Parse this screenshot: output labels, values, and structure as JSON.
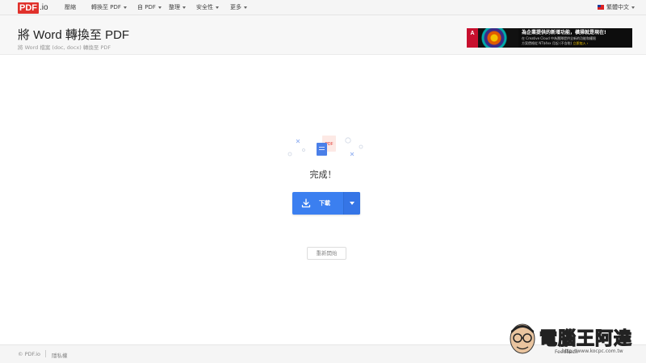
{
  "nav": {
    "logo_pdf": "PDF",
    "logo_io": ".io",
    "items": [
      {
        "label": "壓縮",
        "dropdown": false
      },
      {
        "label": "轉換至 PDF",
        "dropdown": true
      },
      {
        "label": "自 PDF",
        "dropdown": true
      },
      {
        "label": "整理",
        "dropdown": true
      },
      {
        "label": "安全性",
        "dropdown": true
      },
      {
        "label": "更多",
        "dropdown": true
      }
    ],
    "language": "繁體中文"
  },
  "header": {
    "title": "將 Word 轉換至 PDF",
    "subtitle": "將 Word 檔案 (doc, docx) 轉換至 PDF"
  },
  "ad": {
    "logo": "A",
    "line1": "為企業提供的新增功能，橫掃就是現在!",
    "line2": "在 Creative Cloud 中為團隊提供全新的功能和權限",
    "line3": "方案價格從 NT$4xx 月起 (不含稅)",
    "cta": "立即加入 ›"
  },
  "main": {
    "file_badge": "PDF",
    "status": "完成！",
    "download_label": "下載",
    "restart_label": "重新開始"
  },
  "footer": {
    "copyright": "© PDF.io",
    "privacy": "隱私權",
    "feedback": "Feedback"
  },
  "watermark": {
    "name": "電腦王阿達",
    "url": "http://www.kocpc.com.tw"
  },
  "colors": {
    "accent": "#3b7ff0",
    "logo_red": "#e0312b",
    "nav_bg": "#f5f5f5"
  }
}
